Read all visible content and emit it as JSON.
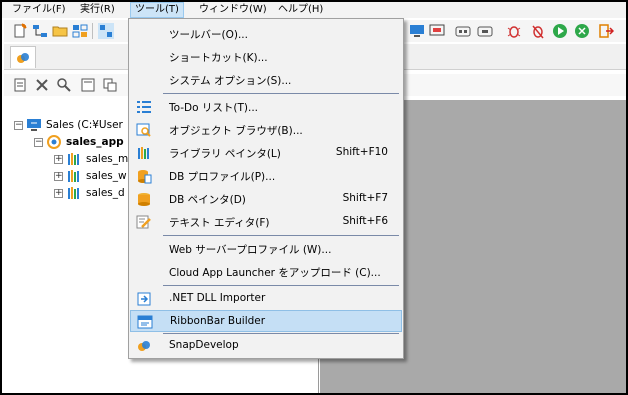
{
  "menubar": {
    "items": [
      "ファイル(F)",
      "実行(R)",
      "ツール(T)",
      "ウィンドウ(W)",
      "ヘルプ(H)"
    ]
  },
  "tree": {
    "root_label": "Sales (C:¥User",
    "app_label": "sales_app",
    "children": [
      "sales_m",
      "sales_w",
      "sales_d"
    ]
  },
  "tools_menu": {
    "items": [
      {
        "label": "ツールバー(O)...",
        "shortcut": "",
        "icon": ""
      },
      {
        "label": "ショートカット(K)...",
        "shortcut": "",
        "icon": ""
      },
      {
        "label": "システム オプション(S)...",
        "shortcut": "",
        "icon": ""
      },
      {
        "label": "To-Do リスト(T)...",
        "shortcut": "",
        "icon": "todo-list-icon"
      },
      {
        "label": "オブジェクト ブラウザ(B)...",
        "shortcut": "",
        "icon": "object-browser-icon"
      },
      {
        "label": "ライブラリ ペインタ(L)",
        "shortcut": "Shift+F10",
        "icon": "library-painter-icon"
      },
      {
        "label": "DB プロファイル(P)...",
        "shortcut": "",
        "icon": "db-profile-icon"
      },
      {
        "label": "DB ペインタ(D)",
        "shortcut": "Shift+F7",
        "icon": "db-painter-icon"
      },
      {
        "label": "テキスト エディタ(F)",
        "shortcut": "Shift+F6",
        "icon": "text-editor-icon"
      },
      {
        "label": "Web サーバープロファイル (W)...",
        "shortcut": "",
        "icon": ""
      },
      {
        "label": "Cloud App Launcher をアップロード (C)...",
        "shortcut": "",
        "icon": ""
      },
      {
        "label": ".NET DLL Importer",
        "shortcut": "",
        "icon": "dll-importer-icon"
      },
      {
        "label": "RibbonBar Builder",
        "shortcut": "",
        "icon": "ribbonbar-builder-icon"
      },
      {
        "label": "SnapDevelop",
        "shortcut": "",
        "icon": "snapdevelop-icon"
      }
    ]
  },
  "colors": {
    "menu_highlight": "#c5dff5",
    "workspace_gray": "#a9a9a9",
    "accent_blue": "#1e6fd6",
    "accent_orange": "#f0a020"
  }
}
